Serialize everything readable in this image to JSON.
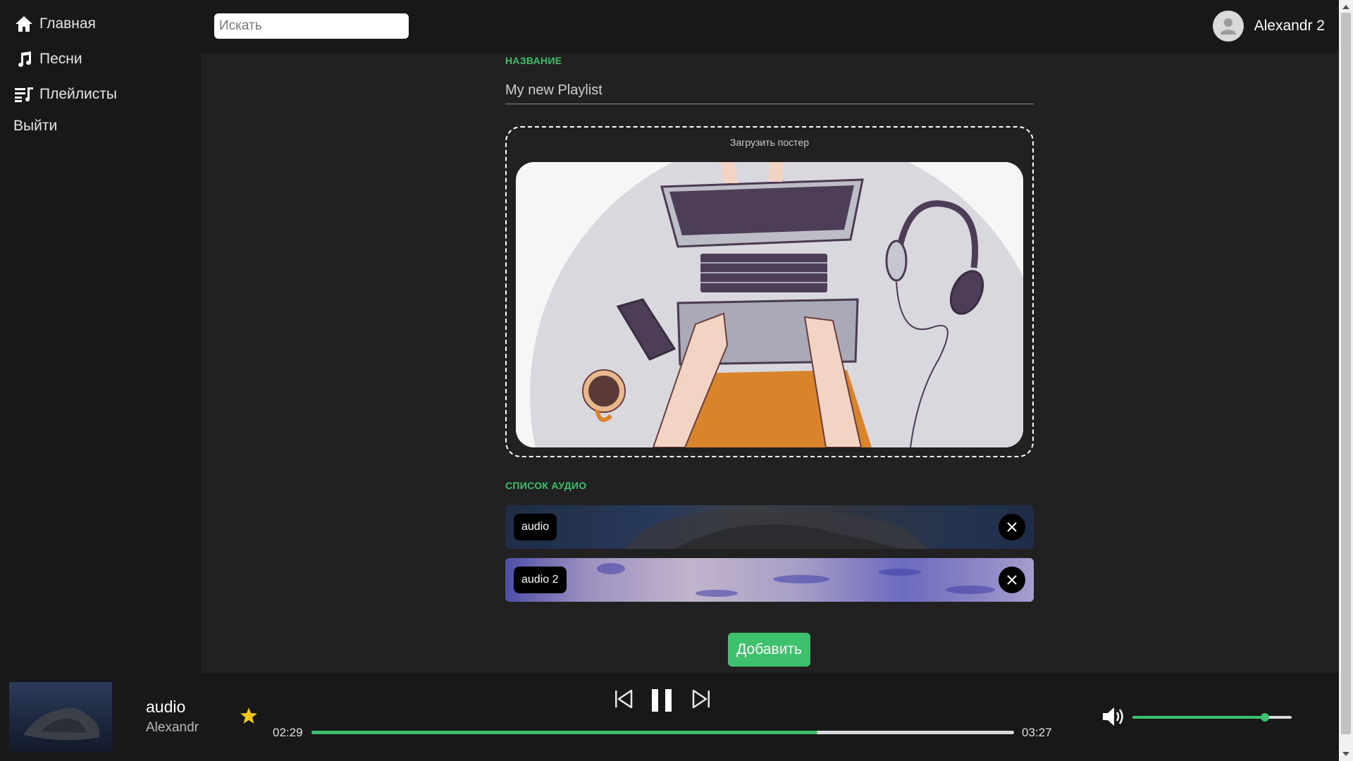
{
  "sidebar": {
    "items": [
      {
        "label": "Главная",
        "icon": "home-icon"
      },
      {
        "label": "Песни",
        "icon": "music-note-icon"
      },
      {
        "label": "Плейлисты",
        "icon": "playlist-icon"
      }
    ],
    "logout_label": "Выйти"
  },
  "header": {
    "search_placeholder": "Искать",
    "username": "Alexandr 2"
  },
  "form": {
    "title_label": "НАЗВАНИЕ",
    "title_value": "My new Playlist",
    "poster_caption": "Загрузить постер",
    "audio_list_label": "СПИСОК АУДИО",
    "audio_items": [
      {
        "name": "audio"
      },
      {
        "name": "audio 2"
      }
    ],
    "add_button": "Добавить"
  },
  "player": {
    "track_title": "audio",
    "track_artist": "Alexandr",
    "current_time": "02:29",
    "total_time": "03:27",
    "progress": 0.72,
    "volume": 0.83,
    "is_playing": true,
    "is_favorite": true
  },
  "colors": {
    "accent": "#3ec16c",
    "background": "#212121",
    "sidebar": "#181818",
    "favorite_star": "#f5c518"
  }
}
